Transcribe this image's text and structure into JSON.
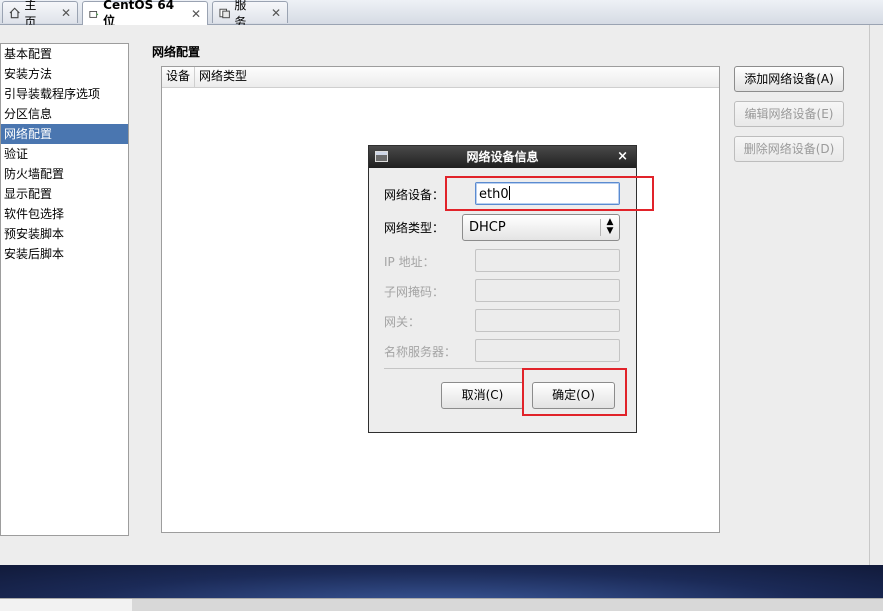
{
  "tabs": [
    {
      "label": "主页",
      "icon": "home-icon"
    },
    {
      "label": "CentOS 64 位",
      "icon": "vm-icon"
    },
    {
      "label": "服务",
      "icon": "services-icon"
    }
  ],
  "sidebar": {
    "items": [
      "基本配置",
      "安装方法",
      "引导装载程序选项",
      "分区信息",
      "网络配置",
      "验证",
      "防火墙配置",
      "显示配置",
      "软件包选择",
      "预安装脚本",
      "安装后脚本"
    ],
    "selected_index": 4
  },
  "main": {
    "section_title": "网络配置",
    "columns": [
      "设备",
      "网络类型"
    ],
    "buttons": {
      "add": "添加网络设备(A)",
      "edit": "编辑网络设备(E)",
      "delete": "删除网络设备(D)"
    }
  },
  "dialog": {
    "title": "网络设备信息",
    "close_glyph": "×",
    "device_label": "网络设备：",
    "device_value": "eth0",
    "type_label": "网络类型：",
    "type_value": "DHCP",
    "ip_label": "IP 地址：",
    "mask_label": "子网掩码：",
    "gateway_label": "网关：",
    "dns_label": "名称服务器：",
    "cancel": "取消(C)",
    "ok": "确定(O)"
  },
  "colors": {
    "highlight": "#e1232a",
    "selection": "#4a76b0",
    "dialog_title_bg": "#2a2a2a"
  }
}
